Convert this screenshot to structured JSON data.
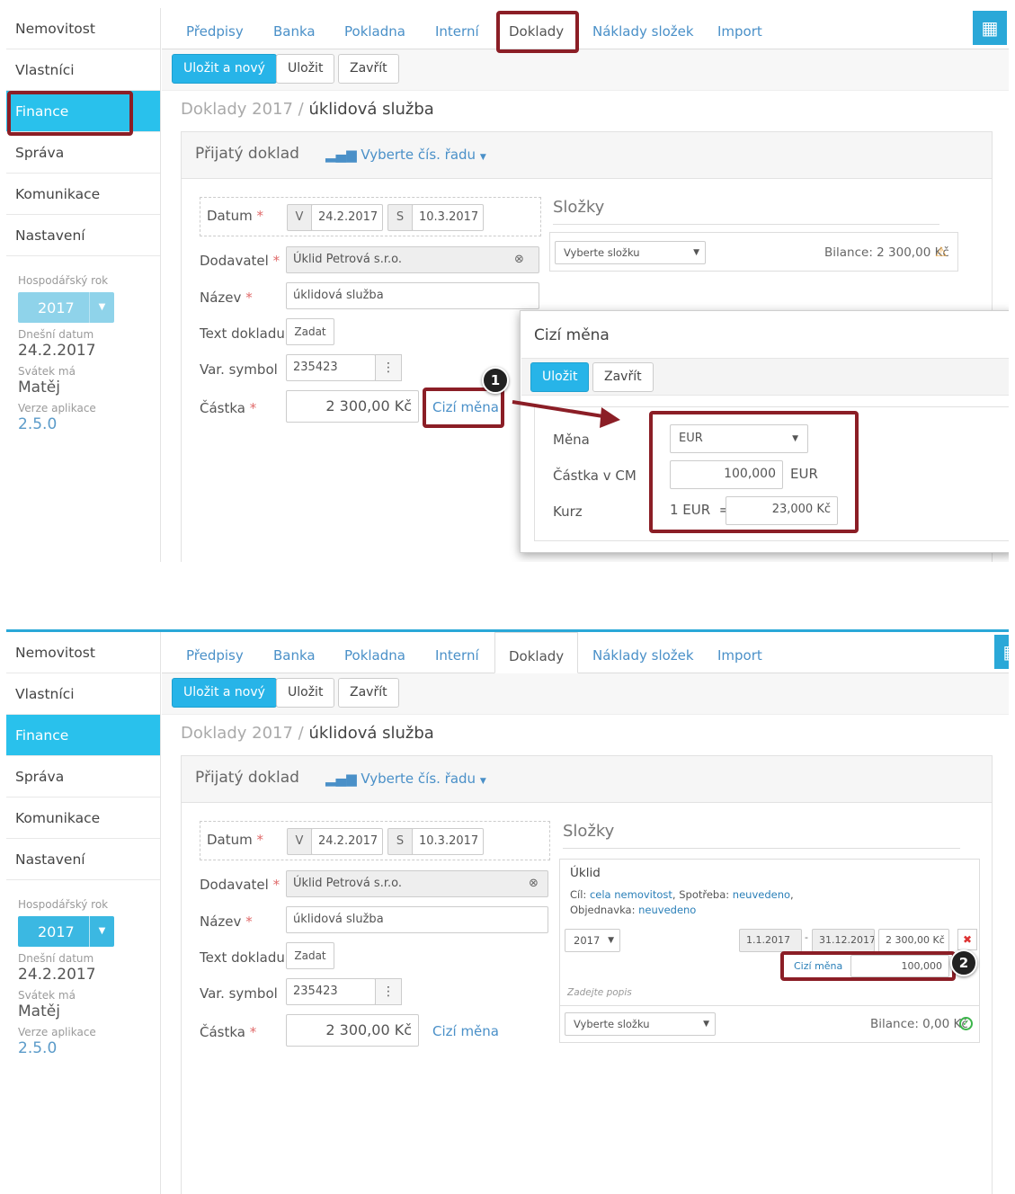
{
  "sidebar": {
    "items": [
      "Nemovitost",
      "Vlastníci",
      "Finance",
      "Správa",
      "Komunikace",
      "Nastavení"
    ],
    "fiscal_year_label": "Hospodářský rok",
    "fiscal_year": "2017",
    "today_label": "Dnešní datum",
    "today": "24.2.2017",
    "nameday_label": "Svátek má",
    "nameday": "Matěj",
    "version_label": "Verze aplikace",
    "version": "2.5.0"
  },
  "tabs": [
    "Předpisy",
    "Banka",
    "Pokladna",
    "Interní",
    "Doklady",
    "Náklady složek",
    "Import"
  ],
  "toolbar": {
    "save_new": "Uložit a nový",
    "save": "Uložit",
    "close": "Zavřít"
  },
  "breadcrumb": {
    "section": "Doklady 2017 /",
    "current": "úklidová služba"
  },
  "card": {
    "title": "Přijatý doklad",
    "series": "Vyberte čís. řadu"
  },
  "form": {
    "date_label": "Datum",
    "v_prefix": "V",
    "v_date": "24.2.2017",
    "s_prefix": "S",
    "s_date": "10.3.2017",
    "supplier_label": "Dodavatel",
    "supplier": "Úklid Petrová s.r.o.",
    "name_label": "Název",
    "name": "úklidová služba",
    "text_label": "Text dokladu",
    "text_button": "Zadat",
    "var_label": "Var. symbol",
    "var_symbol": "235423",
    "amount_label": "Částka",
    "amount": "2 300,00 Kč",
    "foreign_link": "Cizí měna"
  },
  "slozky": {
    "title": "Složky",
    "select_placeholder": "Vyberte složku",
    "balance1": "Bilance: 2 300,00 Kč",
    "balance2": "Bilance: 0,00 Kč",
    "component_title": "Úklid",
    "cil_label": "Cíl:",
    "cil_value": "cela nemovitost",
    "spotreba_label": "Spotřeba:",
    "spotreba_value": "neuvedeno",
    "objednavka_label": "Objednavka:",
    "objednavka_value": "neuvedeno",
    "year": "2017",
    "from": "1.1.2017",
    "to": "31.12.2017",
    "amount": "2 300,00 Kč",
    "foreign_label": "Cizí měna",
    "foreign_value": "100,000",
    "description_placeholder": "Zadejte popis",
    "remove_symbol": "✖"
  },
  "modal": {
    "title": "Cizí měna",
    "save": "Uložit",
    "close": "Zavřít",
    "currency_label": "Měna",
    "currency": "EUR",
    "amount_label": "Částka v CM",
    "amount": "100,000",
    "amount_unit": "EUR",
    "rate_label": "Kurz",
    "rate_prefix": "1 EUR  =",
    "rate": "23,000 Kč"
  },
  "annotations": {
    "badge1": "1",
    "badge2": "2"
  },
  "colors": {
    "accent": "#29c1ec",
    "link": "#4a90c8",
    "highlight": "#8b1e26"
  },
  "icons": {
    "calendar": "calendar-icon",
    "clear": "clear-icon",
    "warning": "warning-icon",
    "ok": "check-circle-icon",
    "bars": "bar-chart-icon",
    "caret": "caret-down-icon"
  }
}
